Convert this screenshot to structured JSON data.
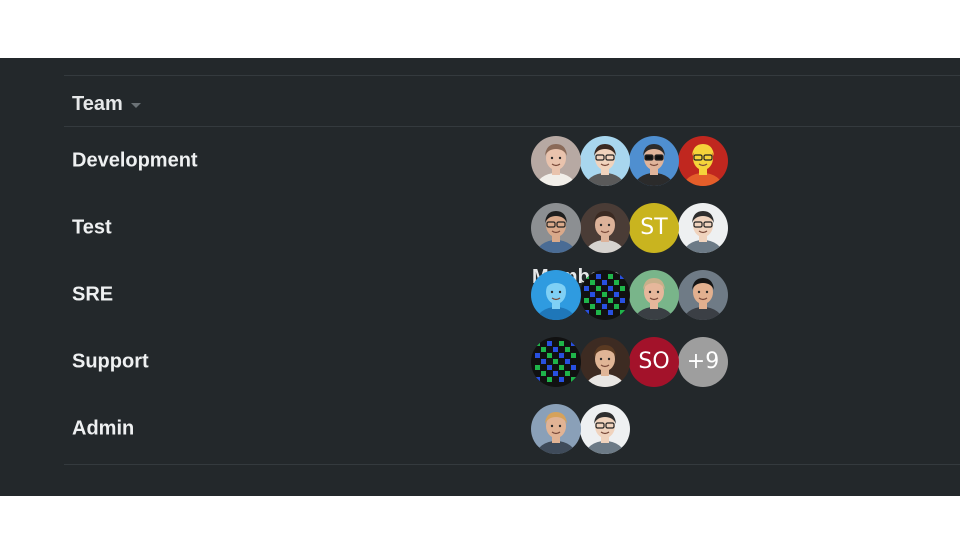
{
  "table": {
    "headers": {
      "team": "Team",
      "members": "Members"
    },
    "sort_icon": "caret-down-icon",
    "rows": [
      {
        "team": "Development",
        "members": [
          {
            "kind": "photo",
            "icon": "woman-photo",
            "bg": "#b7a9a3",
            "skin": "#e9c3ad",
            "hair": "#8a6a58",
            "shirt": "#f1eee9"
          },
          {
            "kind": "photo",
            "icon": "cartoon-man-glasses",
            "bg": "#a8d6ee",
            "skin": "#f0d3bd",
            "hair": "#3a2a22",
            "shirt": "#5a5a5a"
          },
          {
            "kind": "photo",
            "icon": "man-sunglasses",
            "bg": "#4f8fd0",
            "skin": "#e0b49a",
            "hair": "#2c2c2c",
            "shirt": "#2b2b2b"
          },
          {
            "kind": "photo",
            "icon": "bart-cartoon",
            "bg": "#c0271f",
            "skin": "#f5d33a",
            "hair": "#f5d33a",
            "shirt": "#e45e2a"
          }
        ]
      },
      {
        "team": "Test",
        "members": [
          {
            "kind": "photo",
            "icon": "man-glasses-photo",
            "bg": "#8c8f92",
            "skin": "#d9a98a",
            "hair": "#1e1e1e",
            "shirt": "#4a6c95"
          },
          {
            "kind": "photo",
            "icon": "man-suit-photo",
            "bg": "#4a3c36",
            "skin": "#dcb299",
            "hair": "#3b2a22",
            "shirt": "#d6d3cf"
          },
          {
            "kind": "initials",
            "text": "ST",
            "bg": "#c9b41f"
          },
          {
            "kind": "photo",
            "icon": "cartoon-man",
            "bg": "#eef0f1",
            "skin": "#f0d3bd",
            "hair": "#2e2e2e",
            "shirt": "#6c7a86"
          }
        ]
      },
      {
        "team": "SRE",
        "members": [
          {
            "kind": "photo",
            "icon": "robot-mascot",
            "bg": "#2f9be0",
            "skin": "#7fd0f5",
            "hair": "#2f9be0",
            "shirt": "#1f77b9"
          },
          {
            "kind": "photo",
            "icon": "pixel-pattern",
            "bg": "#111111",
            "skin": "#1fb54a",
            "hair": "#e02424",
            "shirt": "#2850e0"
          },
          {
            "kind": "photo",
            "icon": "man-outdoors-photo",
            "bg": "#79b58a",
            "skin": "#e6b79b",
            "hair": "#c9b08a",
            "shirt": "#3a3f44"
          },
          {
            "kind": "photo",
            "icon": "smiling-man-photo",
            "bg": "#6f7b86",
            "skin": "#e2b08f",
            "hair": "#151515",
            "shirt": "#3b3f45"
          }
        ]
      },
      {
        "team": "Support",
        "members": [
          {
            "kind": "photo",
            "icon": "pixel-pattern",
            "bg": "#111111",
            "skin": "#1fb54a",
            "hair": "#e02424",
            "shirt": "#2850e0"
          },
          {
            "kind": "photo",
            "icon": "man-tie-photo",
            "bg": "#3d2b22",
            "skin": "#e0b596",
            "hair": "#5a3a22",
            "shirt": "#e8e6e3"
          },
          {
            "kind": "initials",
            "text": "SO",
            "bg": "#a3122a"
          },
          {
            "kind": "initials",
            "text": "+9",
            "bg": "#9e9e9e"
          }
        ]
      },
      {
        "team": "Admin",
        "members": [
          {
            "kind": "photo",
            "icon": "man-helmet-photo",
            "bg": "#8aa0b8",
            "skin": "#e1b394",
            "hair": "#d6a25a",
            "shirt": "#3f4b5a"
          },
          {
            "kind": "photo",
            "icon": "cartoon-man",
            "bg": "#eef0f1",
            "skin": "#f0d3bd",
            "hair": "#2e2e2e",
            "shirt": "#6c7a86"
          }
        ]
      }
    ]
  }
}
